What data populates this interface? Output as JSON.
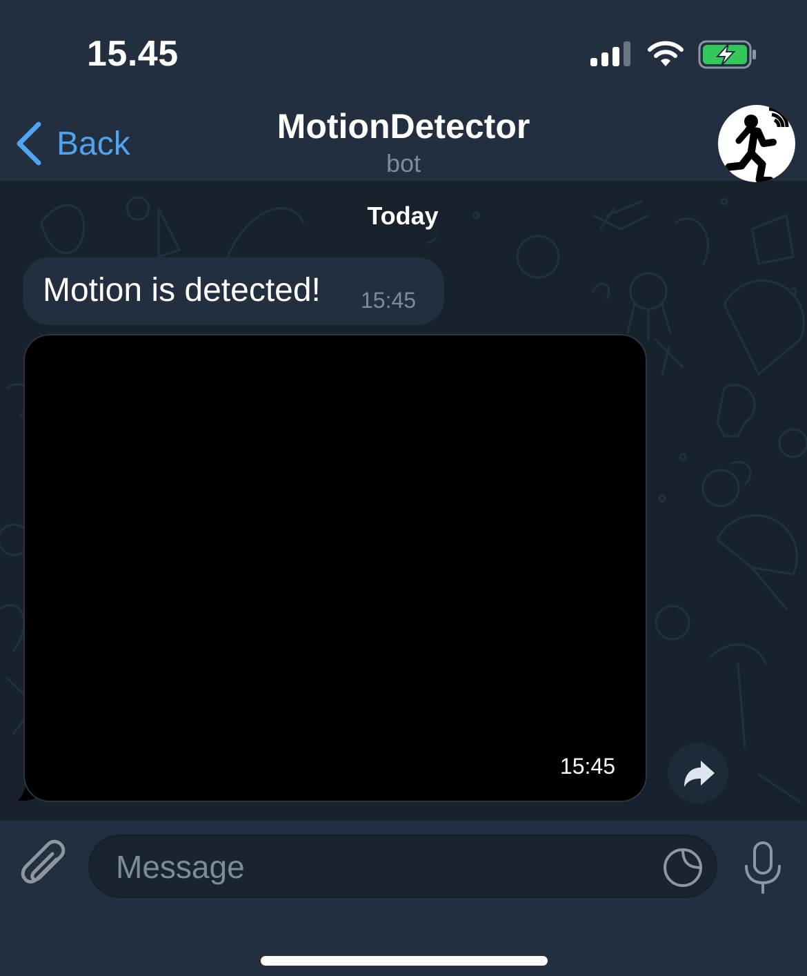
{
  "status_bar": {
    "time": "15.45",
    "icons": [
      "signal-icon",
      "wifi-icon",
      "battery-charging-icon"
    ]
  },
  "nav": {
    "back_label": "Back",
    "title": "MotionDetector",
    "subtitle": "bot",
    "avatar_icon": "running-person-motion-icon"
  },
  "chat": {
    "date_label": "Today",
    "messages": [
      {
        "type": "text",
        "text": "Motion is detected!",
        "time": "15:45"
      },
      {
        "type": "photo",
        "time": "15:45"
      }
    ],
    "forward_icon": "forward-arrow-icon"
  },
  "input": {
    "placeholder": "Message",
    "value": "",
    "attach_icon": "paperclip-icon",
    "sticker_icon": "sticker-icon",
    "mic_icon": "microphone-icon"
  },
  "colors": {
    "accent": "#4fa3ef",
    "bar_background": "#232f3e",
    "chat_background": "#18222d",
    "secondary_text": "#7f8b99",
    "battery_fill": "#34c759"
  }
}
